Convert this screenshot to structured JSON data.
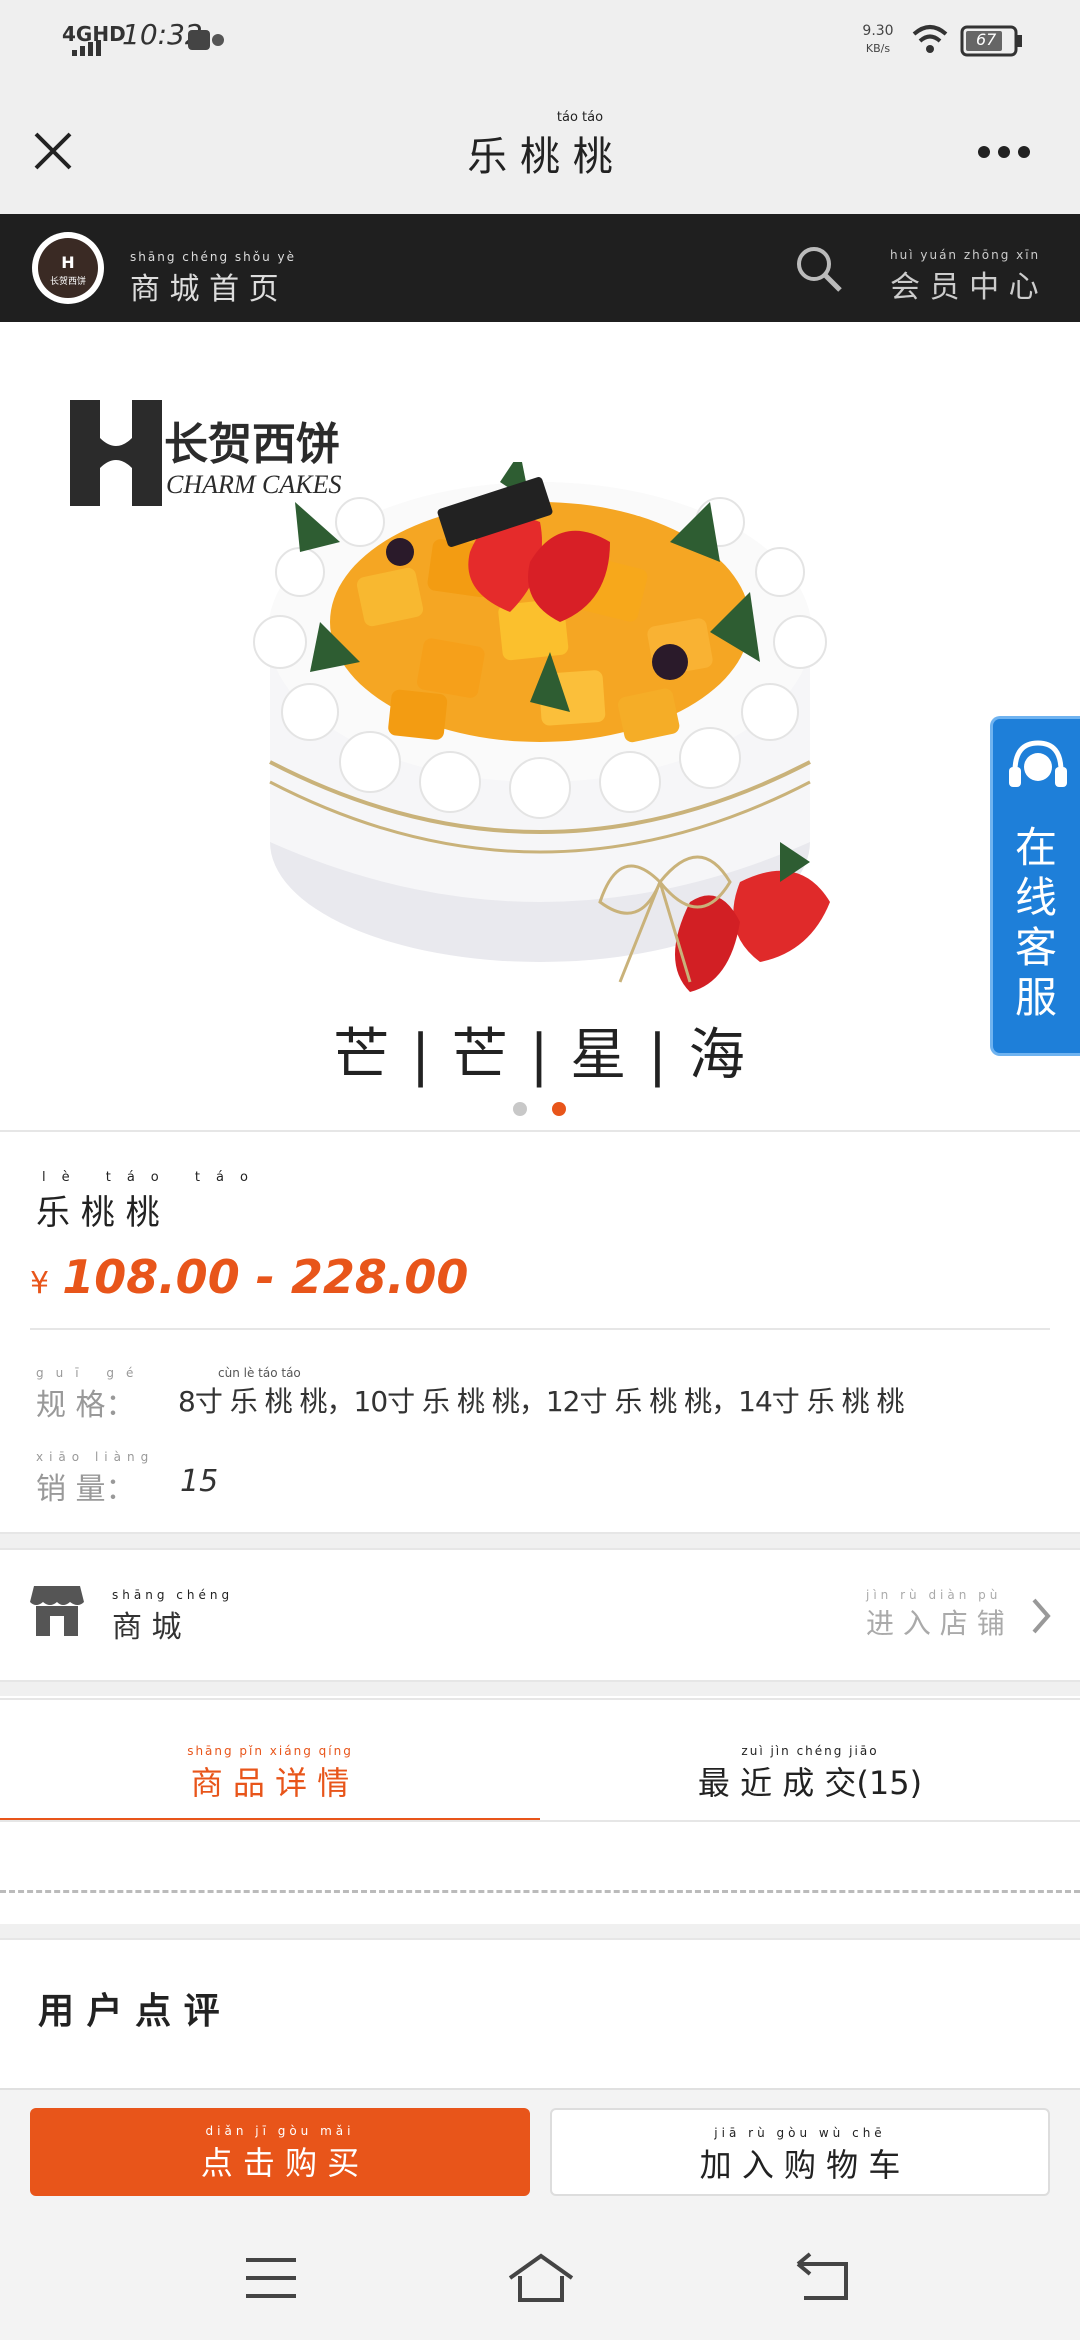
{
  "status": {
    "network": "4GHD",
    "time": "10:32",
    "speed_value": "9.30",
    "speed_unit": "KB/s",
    "battery": "67"
  },
  "nav": {
    "title": "乐 桃 桃",
    "title_pinyin": "táo táo"
  },
  "shop_header": {
    "home_label": "商 城 首 页",
    "home_pinyin": "shāng chéng shǒu yè",
    "member_label": "会 员 中 心",
    "member_pinyin": "huì yuán zhōng xīn",
    "logo_text": "长贺西饼"
  },
  "hero": {
    "brand_cn": "长贺西饼",
    "brand_en": "CHARM CAKES",
    "caption": "芒 | 芒 | 星 | 海",
    "service_label": "在线客服",
    "slide_count": 2,
    "active_slide": 2,
    "colors": {
      "accent": "#e8551a",
      "service_blue": "#1e7fd9"
    }
  },
  "product": {
    "name": "乐 桃 桃",
    "name_pinyin": "lè táo táo",
    "currency": "¥",
    "price_range": "108.00 - 228.00",
    "spec_label": "规 格：",
    "spec_label_pinyin": "guī gé",
    "spec_value": "8寸 乐 桃 桃，10寸 乐 桃 桃，12寸 乐 桃 桃，14寸 乐 桃 桃",
    "spec_value_pinyin": "cùn lè táo táo",
    "sales_label": "销 量：",
    "sales_label_pinyin": "xiāo liàng",
    "sales_value": "15"
  },
  "store": {
    "name": "商 城",
    "name_pinyin": "shāng chéng",
    "enter_label": "进 入 店 铺",
    "enter_pinyin": "jìn rù diàn pù"
  },
  "tabs": [
    {
      "label": "商 品 详 情",
      "pinyin": "shāng pǐn xiáng qíng",
      "active": true
    },
    {
      "label": "最 近 成 交(15)",
      "pinyin": "zuì jìn chéng jiāo",
      "active": false
    }
  ],
  "reviews": {
    "title": "用 户 点 评"
  },
  "buy_bar": {
    "buy_now": "点 击 购 买",
    "buy_now_pinyin": "diǎn jī gòu mǎi",
    "add_cart": "加 入 购 物 车",
    "add_cart_pinyin": "jiā rù gòu wù chē"
  }
}
